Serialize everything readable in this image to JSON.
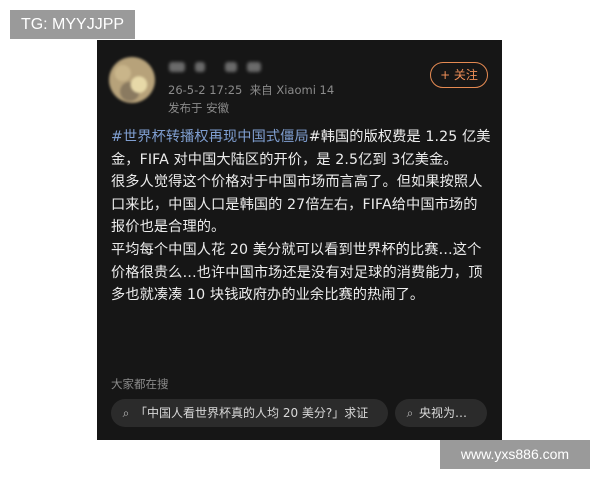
{
  "watermark_top": "TG: MYYJJPP",
  "watermark_bottom": "www.yxs886.com",
  "post": {
    "timestamp": "26-5-2 17:25",
    "device": "来自 Xiaomi 14",
    "location": "发布于 安徽",
    "follow_label": "+ 关注",
    "hashtag": "#世界杯转播权再现中国式僵局",
    "paragraph_1_rest": "#韩国的版权费是 1.25 亿美金，FIFA 对中国大陆区的开价，是 2.5亿到 3亿美金。",
    "paragraph_2": "很多人觉得这个价格对于中国市场而言高了。但如果按照人口来比，中国人口是韩国的 27倍左右，FIFA给中国市场的报价也是合理的。",
    "paragraph_3": "平均每个中国人花 20 美分就可以看到世界杯的比赛…这个价格很贵么…也许中国市场还是没有对足球的消费能力，顶多也就凑凑 10 块钱政府办的业余比赛的热闹了。"
  },
  "search_section": {
    "title": "大家都在搜",
    "suggestions": [
      {
        "icon": "search-icon",
        "text": "「中国人看世界杯真的人均 20 美分?」求证"
      },
      {
        "icon": "search-icon",
        "text": "央视为…"
      }
    ]
  },
  "colors": {
    "card_bg": "#161616",
    "hashtag": "#7f9ed0",
    "follow_accent": "#ef8f58",
    "pill_bg": "#2b2b2b"
  }
}
